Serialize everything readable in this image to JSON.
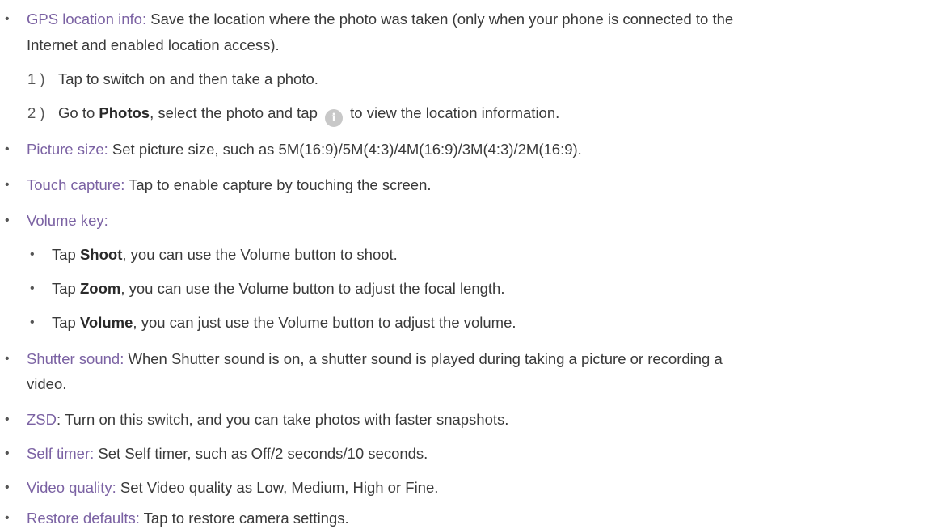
{
  "items": {
    "gps": {
      "term": "GPS location info:",
      "line1": " Save the location where the photo was taken (only when your phone is connected to the",
      "line2": "Internet and enabled location access).",
      "steps": [
        {
          "num": "1 )",
          "text": "Tap to switch on and then take a photo."
        },
        {
          "num": "2 )",
          "pre": "Go to ",
          "bold": "Photos",
          "mid": ", select the photo and tap ",
          "icon": "i",
          "post": " to view the location information."
        }
      ]
    },
    "picture_size": {
      "term": "Picture size:",
      "text": " Set picture size, such as 5M(16:9)/5M(4:3)/4M(16:9)/3M(4:3)/2M(16:9)."
    },
    "touch_capture": {
      "term": "Touch capture:",
      "text": " Tap to enable capture by touching the screen."
    },
    "volume_key": {
      "term": "Volume key:",
      "subs": [
        {
          "pre": "Tap ",
          "bold": "Shoot",
          "post": ", you can use the Volume button to shoot."
        },
        {
          "pre": "Tap ",
          "bold": "Zoom",
          "post": ", you can use the Volume button to adjust the focal length."
        },
        {
          "pre": "Tap ",
          "bold": "Volume",
          "post": ", you can just use the Volume button to adjust the volume."
        }
      ]
    },
    "shutter_sound": {
      "term": "Shutter sound:",
      "line1": " When Shutter sound is on, a shutter sound is played during taking a picture or recording a",
      "line2": "video."
    },
    "zsd": {
      "term": "ZSD",
      "text": ": Turn on this switch, and you can take photos with faster snapshots."
    },
    "self_timer": {
      "term": "Self timer:",
      "text": " Set Self timer, such as Off/2 seconds/10 seconds."
    },
    "video_quality": {
      "term": "Video quality:",
      "text": " Set Video quality as Low, Medium, High or Fine."
    },
    "restore_defaults": {
      "term": "Restore defaults:",
      "text": " Tap to restore camera settings."
    }
  },
  "bullet_char": "•",
  "colors": {
    "term": "#7b62a3",
    "body": "#3a3a3a",
    "icon_bg": "#c8c8c8"
  },
  "icons": {
    "info": "info-icon"
  }
}
